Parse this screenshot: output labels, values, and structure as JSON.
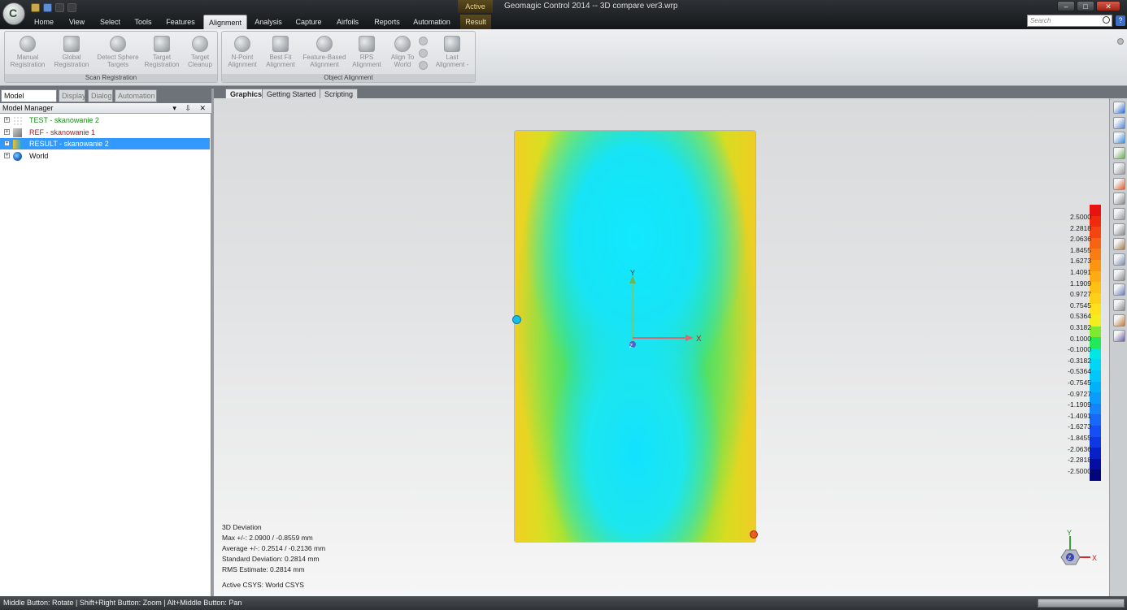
{
  "app": {
    "title": "Geomagic Control 2014 -- 3D compare ver3.wrp",
    "context_tag": "Active"
  },
  "menu": {
    "tabs": [
      "Home",
      "View",
      "Select",
      "Tools",
      "Features",
      "Alignment",
      "Analysis",
      "Capture",
      "Airfoils",
      "Reports",
      "Automation",
      "Result"
    ],
    "active_tab": "Alignment",
    "search_placeholder": "Search",
    "help_label": "?"
  },
  "ribbon": {
    "groups": [
      {
        "label": "Scan Registration",
        "buttons": [
          {
            "line1": "Manual",
            "line2": "Registration",
            "icon": "manual-registration-icon"
          },
          {
            "line1": "Global",
            "line2": "Registration",
            "icon": "global-registration-icon"
          },
          {
            "line1": "Detect Sphere",
            "line2": "Targets",
            "icon": "detect-sphere-icon"
          },
          {
            "line1": "Target",
            "line2": "Registration",
            "icon": "target-registration-icon"
          },
          {
            "line1": "Target",
            "line2": "Cleanup",
            "icon": "target-cleanup-icon"
          }
        ]
      },
      {
        "label": "Object Alignment",
        "buttons": [
          {
            "line1": "N-Point",
            "line2": "Alignment",
            "icon": "n-point-icon"
          },
          {
            "line1": "Best Fit",
            "line2": "Alignment",
            "icon": "best-fit-icon"
          },
          {
            "line1": "Feature-Based",
            "line2": "Alignment",
            "icon": "feature-based-icon"
          },
          {
            "line1": "RPS",
            "line2": "Alignment",
            "icon": "rps-icon"
          },
          {
            "line1": "Align To",
            "line2": "World",
            "icon": "align-to-world-icon"
          },
          {
            "line1": "Last",
            "line2": "Alignment -",
            "icon": "last-alignment-icon"
          }
        ]
      }
    ]
  },
  "left_panel": {
    "tabs": [
      "Model Manager",
      "Display",
      "Dialog",
      "Automation"
    ],
    "active_tab": "Model Manager",
    "header": "Model Manager",
    "header_controls": "▾ ⇩ ✕",
    "tree": [
      {
        "label": "TEST - skanowanie 2",
        "color": "#1a8a1a",
        "icon": "point-cloud-icon"
      },
      {
        "label": "REF - skanowanie 1",
        "color": "#b01818",
        "icon": "mesh-icon"
      },
      {
        "label": "RESULT - skanowanie 2",
        "color": "#ffffff",
        "icon": "result-icon",
        "selected": true
      },
      {
        "label": "World",
        "color": "#111111",
        "icon": "globe-icon"
      }
    ]
  },
  "graphics": {
    "tabs": [
      "Graphics",
      "Getting Started",
      "Scripting"
    ],
    "active_tab": "Graphics",
    "axis_labels": {
      "x": "X",
      "y": "Y",
      "z": "Z"
    },
    "stats": {
      "title": "3D Deviation",
      "max": "Max +/-: 2.0900 / -0.8559 mm",
      "average": "Average +/-: 0.2514 / -0.2136 mm",
      "std": "Standard Deviation: 0.2814 mm",
      "rms": "RMS Estimate: 0.2814 mm",
      "csys": "Active CSYS: World CSYS"
    },
    "legend": {
      "values": [
        "2.5000",
        "2.2818",
        "2.0636",
        "1.8455",
        "1.6273",
        "1.4091",
        "1.1909",
        "0.9727",
        "0.7545",
        "0.5364",
        "0.3182",
        "0.1000",
        "-0.1000",
        "-0.3182",
        "-0.5364",
        "-0.7545",
        "-0.9727",
        "-1.1909",
        "-1.4091",
        "-1.6273",
        "-1.8455",
        "-2.0636",
        "-2.2818",
        "-2.5000"
      ],
      "colors": [
        "#e8120e",
        "#ef2a0d",
        "#f44510",
        "#f86312",
        "#fb7c12",
        "#fd9512",
        "#feab14",
        "#ffc014",
        "#ffd017",
        "#ffe11c",
        "#f2ee1e",
        "#7fe830",
        "#23e85a",
        "#00e7e4",
        "#00d7f7",
        "#00c6fa",
        "#00b2fc",
        "#0a9cfd",
        "#1384fc",
        "#1769f8",
        "#134ff2",
        "#0d38e3",
        "#0820c8",
        "#040ea2",
        "#02067a"
      ]
    },
    "triad_labels": {
      "x": "X",
      "y": "Y",
      "z": "Z"
    }
  },
  "right_toolbar": {
    "icons": [
      "view-icon",
      "rotate-icon",
      "pan-icon",
      "fit-icon",
      "zoom-icon",
      "color-icon",
      "grid-icon",
      "clip-icon",
      "measure-icon",
      "select-icon",
      "lasso-icon",
      "brush-icon",
      "filter-icon",
      "snapshot-icon",
      "cube-icon",
      "render-icon"
    ]
  },
  "status": {
    "hint": "Middle Button: Rotate | Shift+Right Button: Zoom | Alt+Middle Button: Pan"
  }
}
